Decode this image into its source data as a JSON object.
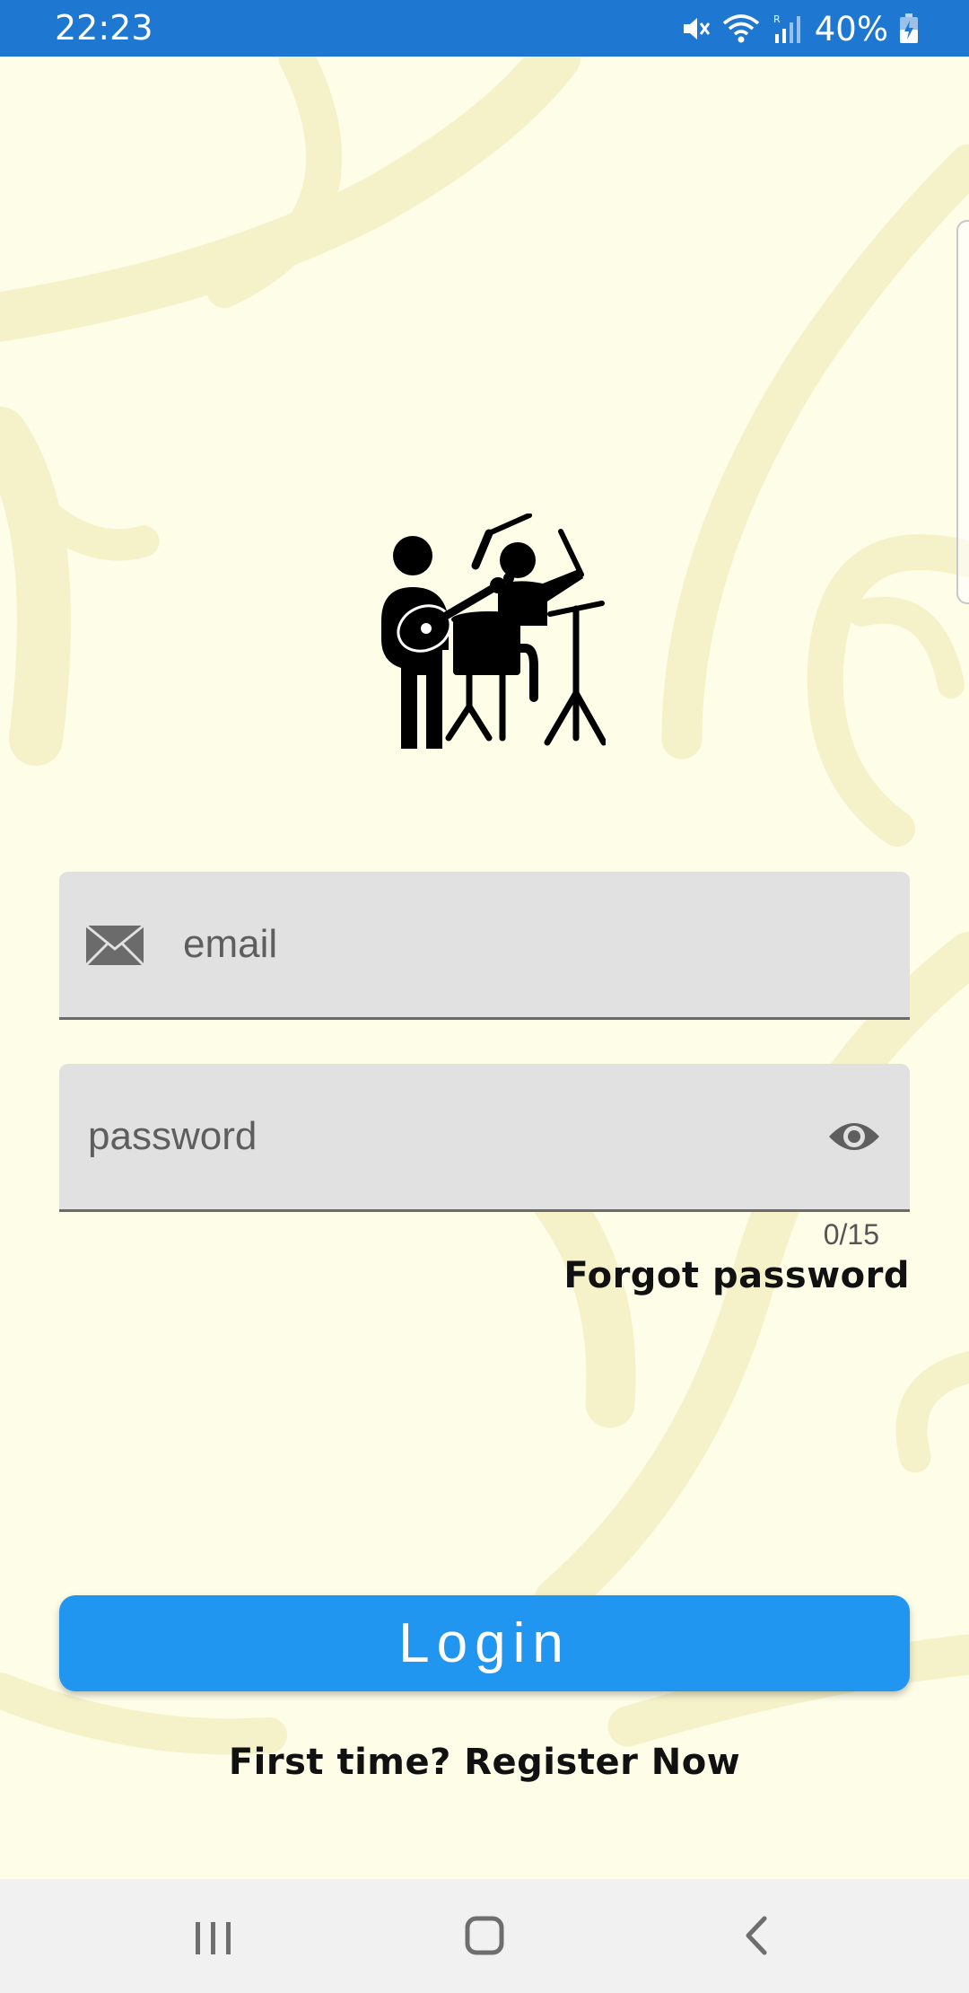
{
  "status_bar": {
    "time": "22:23",
    "battery_percent": "40%",
    "icons": [
      "mute-icon",
      "wifi-icon",
      "signal-icon",
      "battery-charging-icon"
    ],
    "background_color": "#1e77d0"
  },
  "app": {
    "logo_icon": "band-musicians-icon",
    "background_pattern": "floral-swirl"
  },
  "email_field": {
    "placeholder": "email",
    "value": "",
    "icon": "mail-icon"
  },
  "password_field": {
    "placeholder": "password",
    "value": "",
    "icon": "eye-icon",
    "counter": "0/15"
  },
  "forgot_password": "Forgot password",
  "login_button": {
    "label": "Login",
    "color": "#2196f0"
  },
  "register_link": "First time? Register Now",
  "nav_bar": {
    "buttons": [
      "recents-icon",
      "home-icon",
      "back-icon"
    ]
  }
}
